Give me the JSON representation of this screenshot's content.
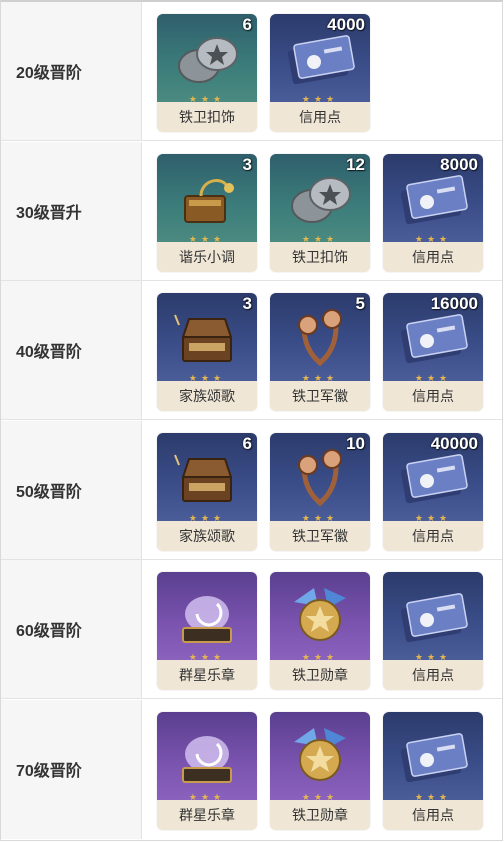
{
  "rows": [
    {
      "label": "20级晋阶",
      "items": [
        {
          "name": "铁卫扣饰",
          "count": "6",
          "bg": "teal",
          "icon": "iron-button-icon"
        },
        {
          "name": "信用点",
          "count": "4000",
          "bg": "blue",
          "icon": "credit-card-icon"
        }
      ]
    },
    {
      "label": "30级晋升",
      "items": [
        {
          "name": "谐乐小调",
          "count": "3",
          "bg": "teal",
          "icon": "music-box-icon"
        },
        {
          "name": "铁卫扣饰",
          "count": "12",
          "bg": "teal",
          "icon": "iron-button-icon"
        },
        {
          "name": "信用点",
          "count": "8000",
          "bg": "blue",
          "icon": "credit-card-icon"
        }
      ]
    },
    {
      "label": "40级晋阶",
      "items": [
        {
          "name": "家族颂歌",
          "count": "3",
          "bg": "blue",
          "icon": "music-chest-icon"
        },
        {
          "name": "铁卫军徽",
          "count": "5",
          "bg": "blue",
          "icon": "military-badge-icon"
        },
        {
          "name": "信用点",
          "count": "16000",
          "bg": "blue",
          "icon": "credit-card-icon"
        }
      ]
    },
    {
      "label": "50级晋阶",
      "items": [
        {
          "name": "家族颂歌",
          "count": "6",
          "bg": "blue",
          "icon": "music-chest-icon"
        },
        {
          "name": "铁卫军徽",
          "count": "10",
          "bg": "blue",
          "icon": "military-badge-icon"
        },
        {
          "name": "信用点",
          "count": "40000",
          "bg": "blue",
          "icon": "credit-card-icon"
        }
      ]
    },
    {
      "label": "60级晋阶",
      "items": [
        {
          "name": "群星乐章",
          "count": "",
          "bg": "purple",
          "icon": "star-music-box-icon"
        },
        {
          "name": "铁卫勋章",
          "count": "",
          "bg": "purple",
          "icon": "medal-icon"
        },
        {
          "name": "信用点",
          "count": "",
          "bg": "blue",
          "icon": "credit-card-icon"
        }
      ]
    },
    {
      "label": "70级晋阶",
      "items": [
        {
          "name": "群星乐章",
          "count": "",
          "bg": "purple",
          "icon": "star-music-box-icon"
        },
        {
          "name": "铁卫勋章",
          "count": "",
          "bg": "purple",
          "icon": "medal-icon"
        },
        {
          "name": "信用点",
          "count": "",
          "bg": "blue",
          "icon": "credit-card-icon"
        }
      ]
    }
  ],
  "colors": {
    "teal_bg": "#3c7d7b",
    "blue_bg": "#3b4e8a",
    "purple_bg": "#7b54b0",
    "name_bg": "#efe6d6",
    "star": "#e3b64f"
  }
}
